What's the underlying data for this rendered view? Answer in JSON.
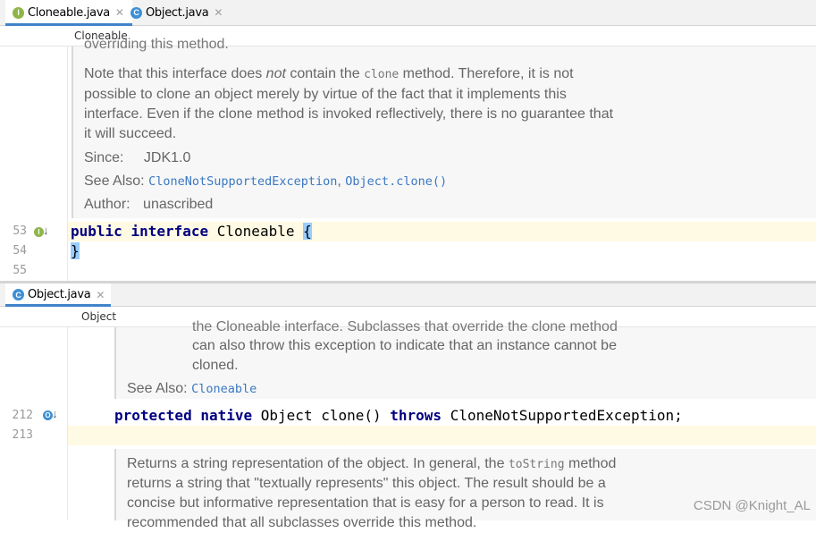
{
  "top_pane": {
    "tabs": [
      {
        "label": "Cloneable.java",
        "icon": "interface-icon",
        "icon_letter": "I",
        "active": true
      },
      {
        "label": "Object.java",
        "icon": "class-icon",
        "icon_letter": "C",
        "active": false
      }
    ],
    "breadcrumb": "Cloneable",
    "doc": {
      "partial_top": "overriding this method.",
      "para_before_not": "Note that this interface does ",
      "para_not": "not",
      "para_after_not": " contain the ",
      "para_code": "clone",
      "para_rest_line1": " method. Therefore, it is not",
      "para_line2": "possible to clone an object merely by virtue of the fact that it implements this",
      "para_line3": "interface. Even if the clone method is invoked reflectively, there is no guarantee that",
      "para_line4": "it will succeed.",
      "since_label": "Since:",
      "since_value": "JDK1.0",
      "see_also_label": "See Also:",
      "see_also_links": [
        "CloneNotSupportedException",
        "Object.clone()"
      ],
      "see_also_sep": ",",
      "author_label": "Author:",
      "author_value": "unascribed"
    },
    "lines": [
      {
        "number": "53",
        "code_kw1": "public",
        "code_kw2": "interface",
        "code_name": " Cloneable ",
        "code_brace": "{"
      },
      {
        "number": "54",
        "code_brace": "}"
      },
      {
        "number": "55"
      }
    ],
    "gutter_badge": "I"
  },
  "bottom_pane": {
    "tabs": [
      {
        "label": "Object.java",
        "icon": "class-icon",
        "icon_letter": "C",
        "active": true
      }
    ],
    "breadcrumb": "Object",
    "doc_top": {
      "partial_line": "the Cloneable interface. Subclasses that override the clone method",
      "line1": "can also throw this exception to indicate that an instance cannot be",
      "line2": "cloned.",
      "see_also_label": "See Also:",
      "see_also_link": "Cloneable"
    },
    "lines": [
      {
        "number": "212",
        "kw1": "protected",
        "kw2": "native",
        "rest1": " Object clone() ",
        "kw3": "throws",
        "rest2": " CloneNotSupportedException;"
      },
      {
        "number": "213"
      }
    ],
    "doc_bottom": {
      "line1_a": "Returns a string representation of the object. In general, the ",
      "line1_code": "toString",
      "line1_b": " method",
      "line2": "returns a string that \"textually represents\" this object. The result should be a",
      "line3": "concise but informative representation that is easy for a person to read. It is",
      "line4_partial": "recommended that all subclasses override this method."
    },
    "gutter_badge": "O"
  },
  "watermark": "CSDN @Knight_AL",
  "colors": {
    "keyword": "#000080",
    "link": "#3a78c2",
    "current_line": "#fffae3",
    "tab_underline": "#4083c9",
    "doc_bg": "#f7f7f7"
  }
}
